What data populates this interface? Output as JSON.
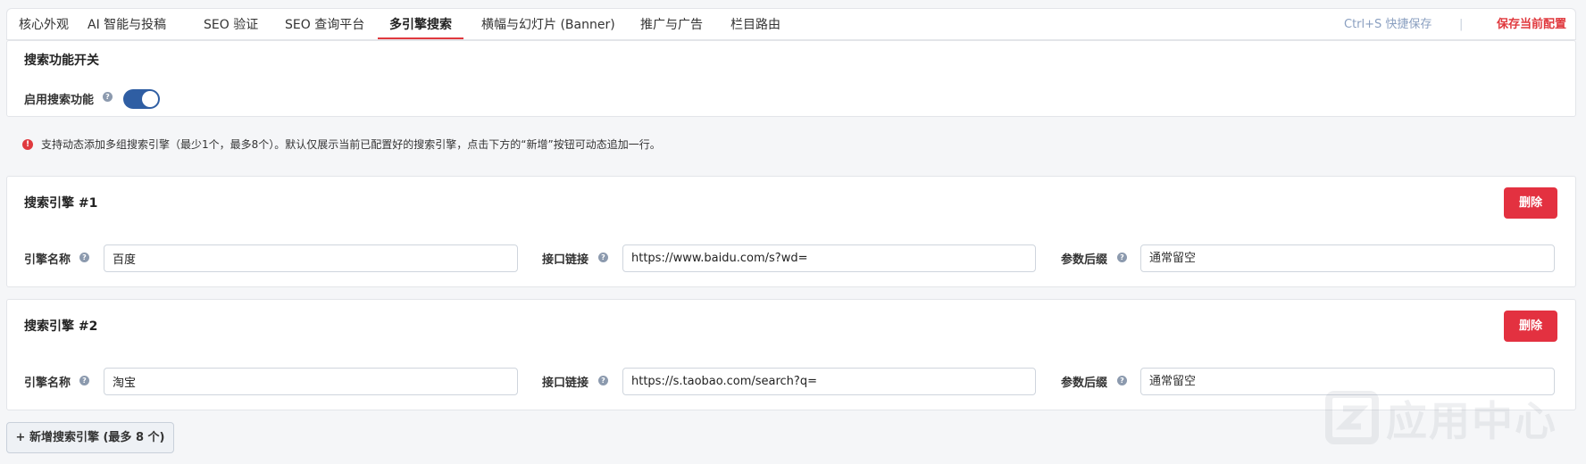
{
  "tabs": [
    {
      "label": "核心外观"
    },
    {
      "label": "AI 智能与投稿"
    },
    {
      "label": "SEO 验证"
    },
    {
      "label": "SEO 查询平台"
    },
    {
      "label": "多引擎搜索",
      "active": true
    },
    {
      "label": "横幅与幻灯片 (Banner)"
    },
    {
      "label": "推广与广告"
    },
    {
      "label": "栏目路由"
    }
  ],
  "header": {
    "shortcut_hint": "Ctrl+S 快捷保存",
    "separator": "|",
    "save_label": "保存当前配置"
  },
  "search_switch": {
    "title": "搜索功能开关",
    "label": "启用搜索功能",
    "enabled": true
  },
  "notice": {
    "icon": "alert-icon",
    "text": "支持动态添加多组搜索引擎（最少1个，最多8个）。默认仅展示当前已配置好的搜索引擎，点击下方的“新增”按钮可动态追加一行。"
  },
  "engines": [
    {
      "title": "搜索引擎 #1",
      "delete_label": "删除",
      "name_label": "引擎名称",
      "name": "百度",
      "url_label": "接口链接",
      "url": "https://www.baidu.com/s?wd=",
      "suffix_label": "参数后缀",
      "suffix_placeholder": "通常留空"
    },
    {
      "title": "搜索引擎 #2",
      "delete_label": "删除",
      "name_label": "引擎名称",
      "name": "淘宝",
      "url_label": "接口链接",
      "url": "https://s.taobao.com/search?q=",
      "suffix_label": "参数后缀",
      "suffix_placeholder": "通常留空"
    }
  ],
  "add_button": {
    "label": "+ 新增搜索引擎 (最多 8 个)"
  },
  "watermark": {
    "text": "应用中心"
  },
  "colors": {
    "accent_red": "#e0393e",
    "toggle_blue": "#2f5ea3",
    "hint_blue": "#8a9fc0"
  }
}
